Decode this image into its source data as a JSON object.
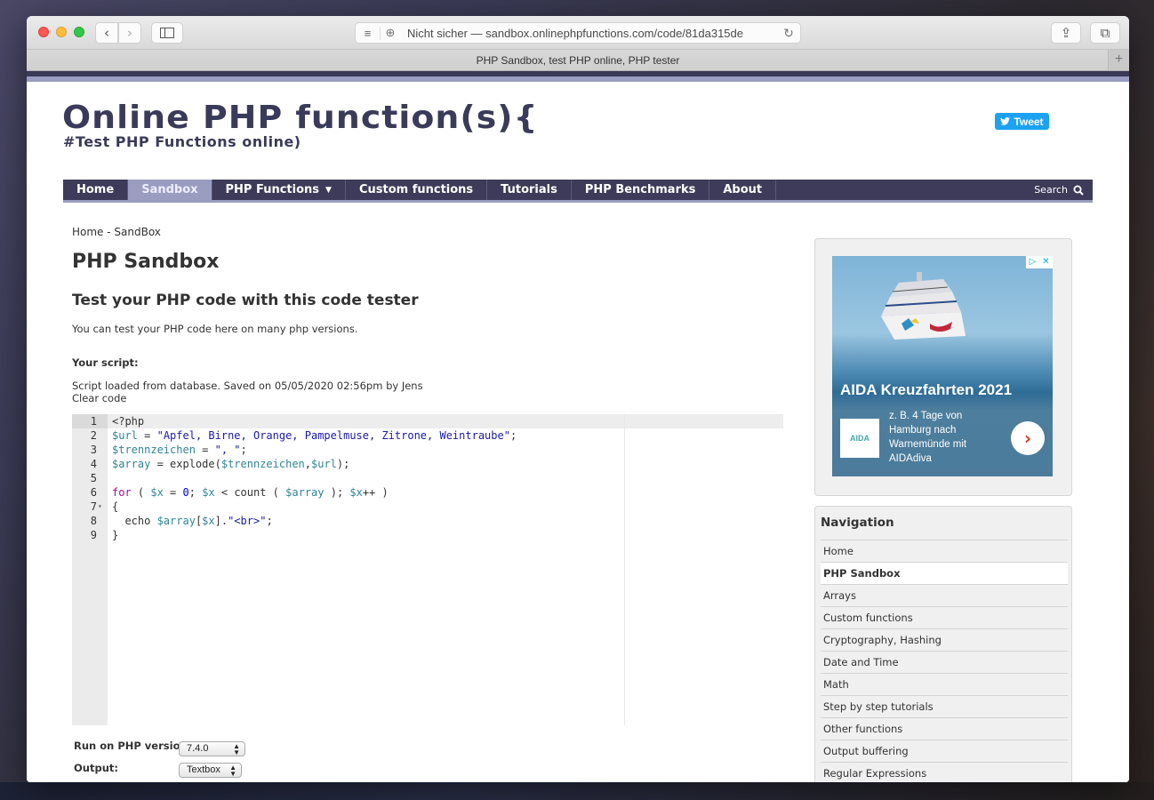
{
  "browser": {
    "address": {
      "security": "Nicht sicher",
      "separator": " — ",
      "url": "sandbox.onlinephpfunctions.com/code/81da315de"
    },
    "tab_title": "PHP Sandbox, test PHP online, PHP tester",
    "icons": {
      "back": "‹",
      "forward": "›",
      "reader": "≡",
      "globe": "⊕",
      "reload": "↻",
      "share": "⇪",
      "tabs": "⧉",
      "new_tab": "+"
    }
  },
  "header": {
    "logo_title": "Online PHP function(s){",
    "logo_subtitle": "#Test PHP Functions online)",
    "tweet_label": "Tweet"
  },
  "mainnav": {
    "items": [
      {
        "label": "Home",
        "active": false
      },
      {
        "label": "Sandbox",
        "active": true
      },
      {
        "label": "PHP Functions",
        "active": false,
        "dropdown": true
      },
      {
        "label": "Custom functions",
        "active": false
      },
      {
        "label": "Tutorials",
        "active": false
      },
      {
        "label": "PHP Benchmarks",
        "active": false
      },
      {
        "label": "About",
        "active": false
      }
    ],
    "caret": "▼",
    "search_label": "Search"
  },
  "content": {
    "breadcrumb": "Home - SandBox",
    "title": "PHP Sandbox",
    "subtitle": "Test your PHP code with this code tester",
    "intro": "You can test your PHP code here on many php versions.",
    "script_label": "Your script:",
    "status": "Script loaded from database. Saved on 05/05/2020 02:56pm by Jens",
    "clear_code": "Clear code"
  },
  "editor": {
    "line_numbers": [
      "1",
      "2",
      "3",
      "4",
      "5",
      "6",
      "7",
      "8",
      "9"
    ],
    "fold_marker": "▾",
    "lines": [
      "<?php",
      "$url = \"Apfel, Birne, Orange, Pampelmuse, Zitrone, Weintraube\";",
      "$trennzeichen = \", \";",
      "$array = explode($trennzeichen,$url);",
      "",
      "for ( $x = 0; $x < count ( $array ); $x++ )",
      "{",
      "  echo $array[$x].\"<br>\";",
      "}"
    ]
  },
  "form": {
    "version_label": "Run on PHP version:",
    "version_value": "7.4.0",
    "output_label": "Output:",
    "output_value": "Textbox",
    "select_arrows": "▲▼"
  },
  "ad": {
    "headline": "AIDA Kreuzfahrten 2021",
    "description": "z. B. 4 Tage von Hamburg nach Warnemünde mit AIDAdiva",
    "logo_text": "AIDA",
    "cta": "›",
    "adchoices": "▷",
    "close": "✕"
  },
  "sidebar_nav": {
    "title": "Navigation",
    "items": [
      {
        "label": "Home",
        "active": false
      },
      {
        "label": "PHP Sandbox",
        "active": true
      },
      {
        "label": "Arrays",
        "active": false
      },
      {
        "label": "Custom functions",
        "active": false
      },
      {
        "label": "Cryptography, Hashing",
        "active": false
      },
      {
        "label": "Date and Time",
        "active": false
      },
      {
        "label": "Math",
        "active": false
      },
      {
        "label": "Step by step tutorials",
        "active": false
      },
      {
        "label": "Other functions",
        "active": false
      },
      {
        "label": "Output buffering",
        "active": false
      },
      {
        "label": "Regular Expressions",
        "active": false
      }
    ]
  },
  "colors": {
    "brand_dark": "#3d3b59",
    "brand_light": "#9a9cc0",
    "tweet_blue": "#1da1f2"
  }
}
